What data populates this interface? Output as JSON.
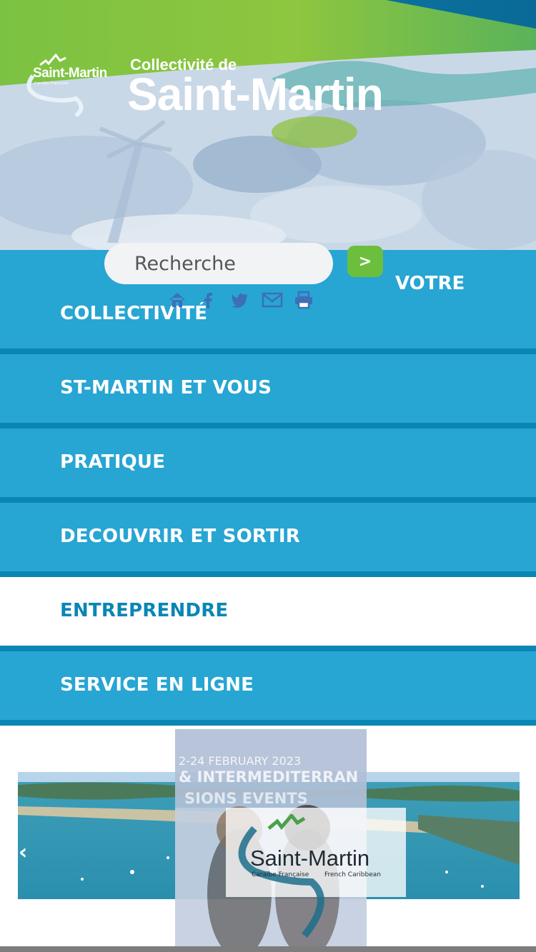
{
  "header": {
    "title_pre": "Collectivité de",
    "title_main": "Saint-Martin",
    "logo_text": "Saint-Martin",
    "logo_sub": "Caraïbe Française"
  },
  "search": {
    "placeholder": "Recherche",
    "button_glyph": ">"
  },
  "nav": {
    "votre_label": "VOTRE",
    "items": [
      {
        "label": "COLLECTIVITÉ"
      },
      {
        "label": "ST-MARTIN ET VOUS"
      },
      {
        "label": "PRATIQUE"
      },
      {
        "label": "DECOUVRIR ET SORTIR"
      },
      {
        "label": "ENTREPRENDRE"
      },
      {
        "label": "SERVICE EN LIGNE"
      }
    ]
  },
  "share": {
    "icons": [
      "home-icon",
      "facebook-icon",
      "twitter-icon",
      "mail-icon",
      "print-icon"
    ]
  },
  "carousel": {
    "logo_text": "Saint-Martin",
    "logo_sub_fr": "Caraïbe Française",
    "logo_sub_en": "French Caribbean",
    "poster_line1": "2-24 FEBRUARY 2023",
    "poster_line2": "& INTERMEDITERRAN",
    "poster_line3": "SIONS EVENTS",
    "prev_glyph": "‹"
  },
  "colors": {
    "nav_blue": "#27a5d3",
    "nav_border": "#0a86b4",
    "search_green": "#6cbf3c",
    "header_green": "#7cc242",
    "header_blue": "#0d7fb0"
  }
}
